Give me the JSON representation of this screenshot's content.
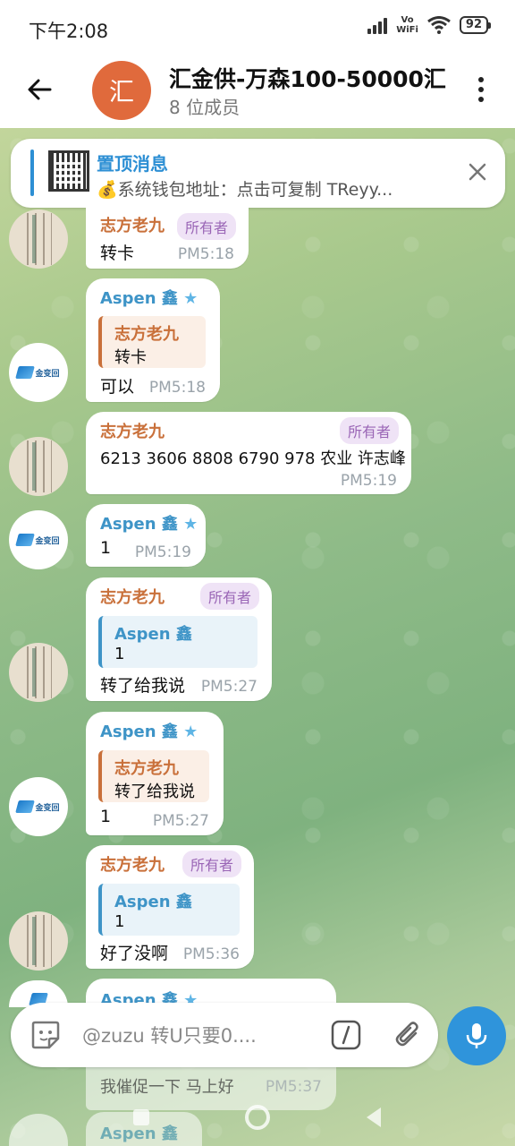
{
  "status_bar": {
    "time": "下午2:08",
    "network": "Vo WiFi",
    "battery": "92"
  },
  "header": {
    "back_label": "←",
    "avatar_initial": "汇",
    "title": "汇金供-万森100-50000汇",
    "subtitle": "8 位成员"
  },
  "pinned": {
    "title": "置顶消息",
    "text": "💰系统钱包地址：点击可复制 TReyy..."
  },
  "messages": [
    {
      "sender": "志方老九",
      "badge": "所有者",
      "text": "转卡",
      "time": "PM5:18"
    },
    {
      "sender": "Aspen 鑫",
      "quote_sender": "志方老九",
      "quote_text": "转卡",
      "text": "可以",
      "time": "PM5:18"
    },
    {
      "sender": "志方老九",
      "badge": "所有者",
      "text": "6213 3606 8808 6790 978 农业  许志峰",
      "time": "PM5:19"
    },
    {
      "sender": "Aspen 鑫",
      "text": "1",
      "time": "PM5:19"
    },
    {
      "sender": "志方老九",
      "badge": "所有者",
      "quote_sender": "Aspen 鑫",
      "quote_text": "1",
      "text": "转了给我说",
      "time": "PM5:27"
    },
    {
      "sender": "Aspen 鑫",
      "quote_sender": "志方老九",
      "quote_text": "转了给我说",
      "text": "1",
      "time": "PM5:27"
    },
    {
      "sender": "志方老九",
      "badge": "所有者",
      "quote_sender": "Aspen 鑫",
      "quote_text": "1",
      "text": "好了没啊",
      "time": "PM5:36"
    },
    {
      "sender": "Aspen 鑫",
      "text": "我催促一下  马上好",
      "time": "PM5:37"
    }
  ],
  "last_visible_sender": "Aspen 鑫",
  "composer": {
    "placeholder": "@zuzu 转U只要0...."
  },
  "avatar_logo_text": "金变回"
}
